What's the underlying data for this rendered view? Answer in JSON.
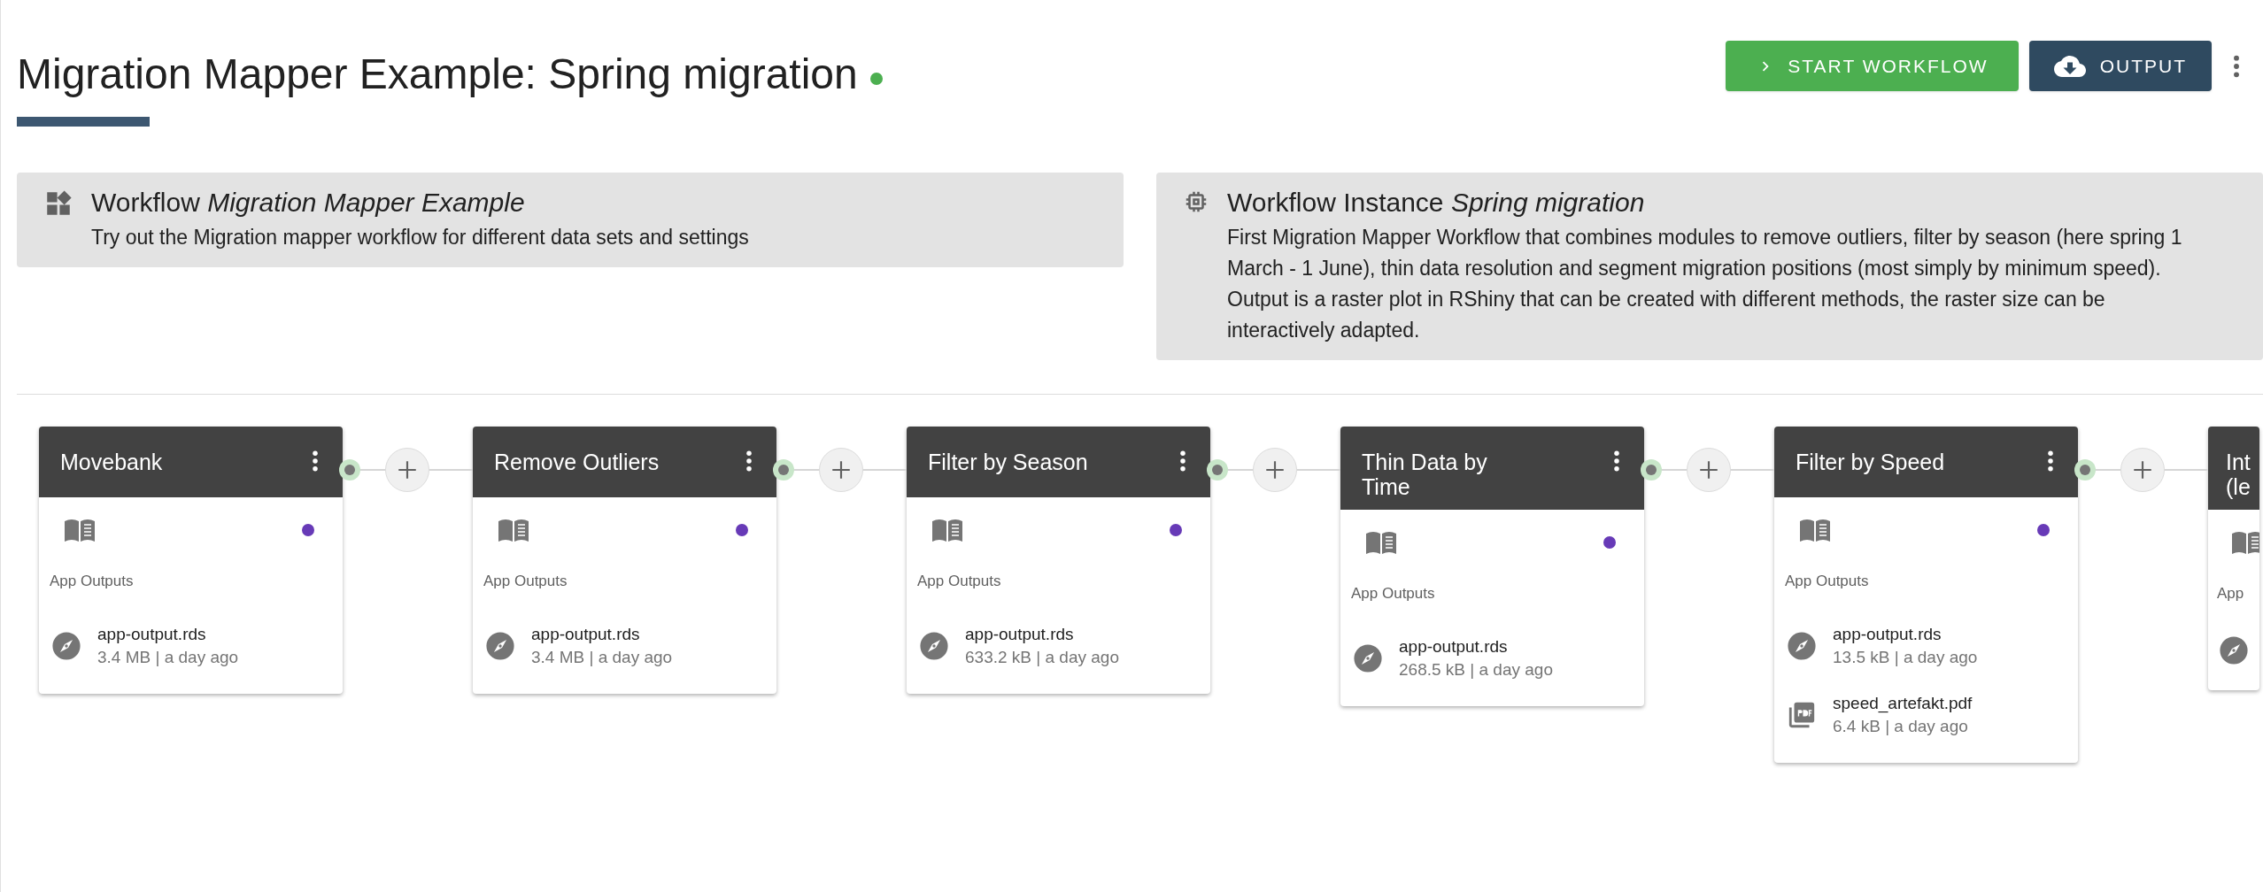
{
  "header": {
    "title": "Migration Mapper Example: Spring migration",
    "online": true
  },
  "actions": [
    {
      "kind": "start",
      "label": "START WORKFLOW"
    },
    {
      "kind": "output",
      "label": "OUTPUT"
    }
  ],
  "info_cards": [
    {
      "kind": "workflow",
      "title": "Workflow *Migration Mapper Example*",
      "description": "Try out the Migration mapper workflow for different data sets and settings"
    },
    {
      "kind": "instance",
      "title": "Workflow Instance *Spring migration*",
      "description": "First Migration Mapper Workflow that combines modules to remove outliers, filter by season (here spring 1 March - 1 June), thin data resolution and segment migration positions (most simply by minimum speed). Output is a raster plot in RShiny that can be created with different methods, the raster size can be interactively adapted."
    }
  ],
  "nodes": [
    {
      "title": "Movebank",
      "color": "#673ab7",
      "section_label": "App Outputs",
      "files": [
        {
          "kind": "rds",
          "name": "app-output.rds",
          "meta": "3.4 MB | a day ago"
        }
      ]
    },
    {
      "title": "Remove Outliers",
      "color": "#673ab7",
      "section_label": "App Outputs",
      "files": [
        {
          "kind": "rds",
          "name": "app-output.rds",
          "meta": "3.4 MB | a day ago"
        }
      ]
    },
    {
      "title": "Filter by Season",
      "color": "#673ab7",
      "section_label": "App Outputs",
      "files": [
        {
          "kind": "rds",
          "name": "app-output.rds",
          "meta": "633.2 kB | a day ago"
        }
      ]
    },
    {
      "title": "Thin Data by Time",
      "color": "#673ab7",
      "section_label": "App Outputs",
      "files": [
        {
          "kind": "rds",
          "name": "app-output.rds",
          "meta": "268.5 kB | a day ago"
        }
      ]
    },
    {
      "title": "Filter by Speed",
      "color": "#673ab7",
      "section_label": "App Outputs",
      "files": [
        {
          "kind": "rds",
          "name": "app-output.rds",
          "meta": "13.5 kB | a day ago"
        },
        {
          "kind": "pdf",
          "name": "speed_artefakt.pdf",
          "meta": "6.4 kB | a day ago"
        }
      ]
    },
    {
      "title": "Int (le",
      "partial": true,
      "section_label": "App",
      "files": [
        {
          "kind": "rds"
        }
      ]
    }
  ]
}
